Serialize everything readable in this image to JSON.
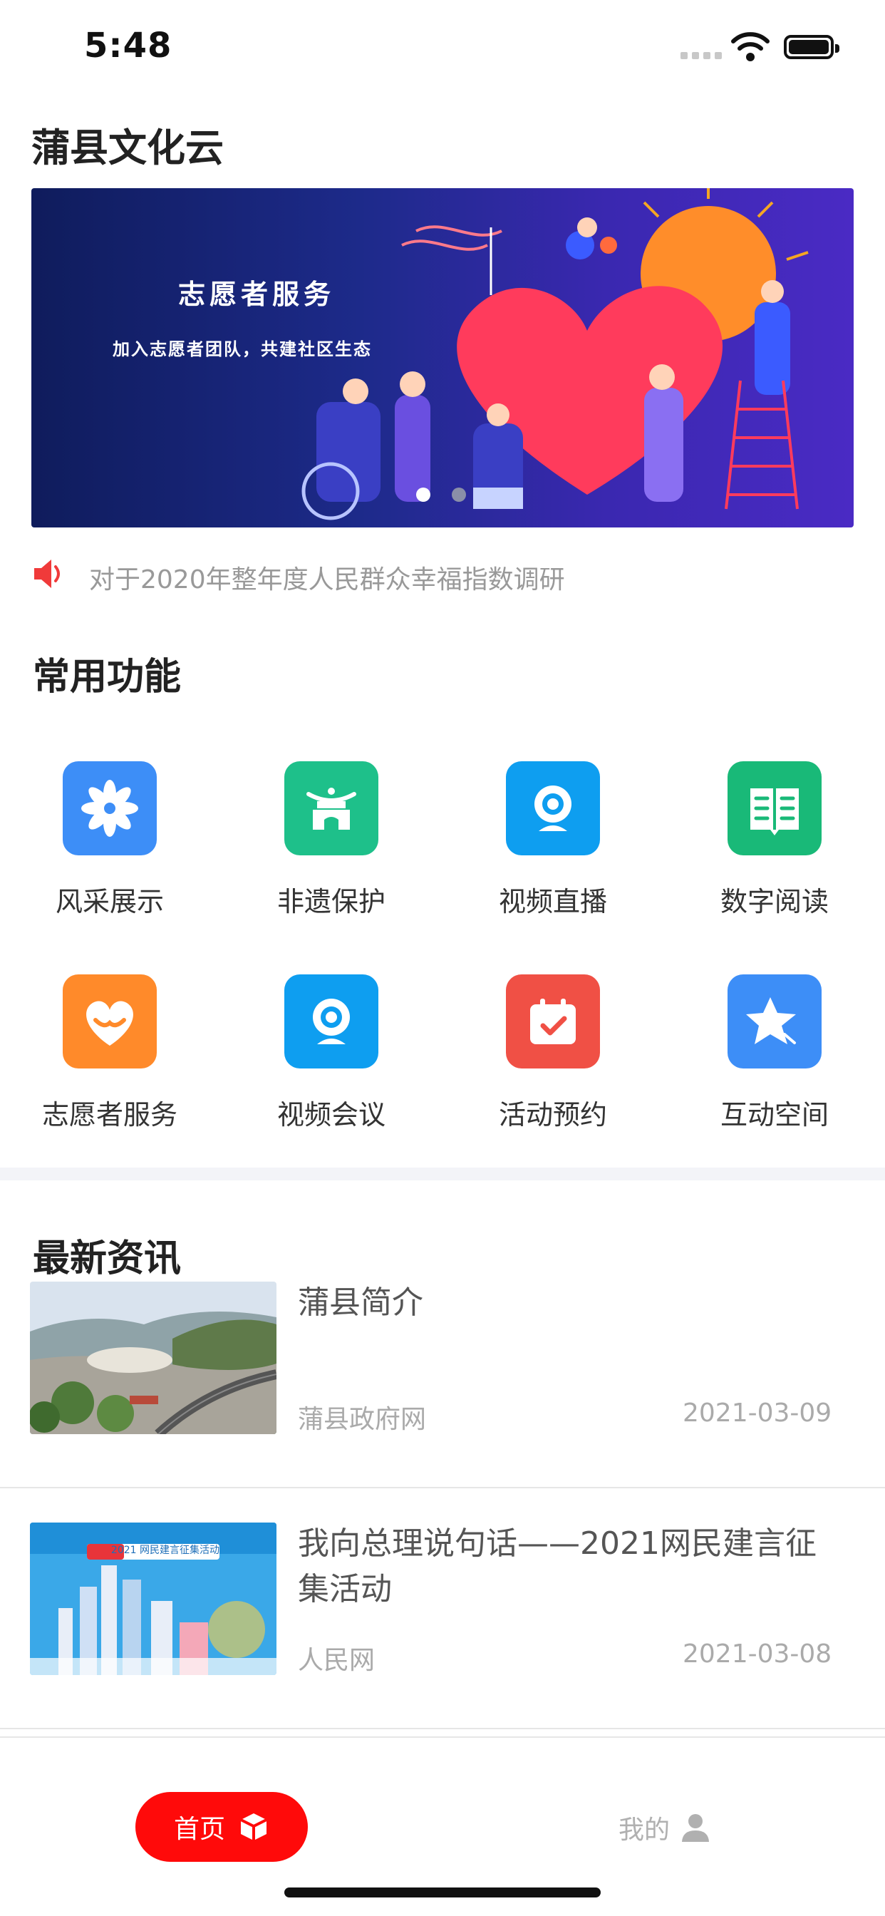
{
  "status_bar": {
    "time": "5:48"
  },
  "app": {
    "title": "蒲县文化云"
  },
  "banner": {
    "title": "志愿者服务",
    "subtitle": "加入志愿者团队，共建社区生态",
    "page_count": 2,
    "active_index": 0
  },
  "notice": {
    "icon": "speaker-icon",
    "text": "对于2020年整年度人民群众幸福指数调研"
  },
  "functions": {
    "section_title": "常用功能",
    "items": [
      {
        "label": "风采展示",
        "icon": "flower-icon",
        "color": "#3d8ef7"
      },
      {
        "label": "非遗保护",
        "icon": "heritage-building-icon",
        "color": "#1ec08a"
      },
      {
        "label": "视频直播",
        "icon": "webcam-icon",
        "color": "#0e9ef0"
      },
      {
        "label": "数字阅读",
        "icon": "open-book-icon",
        "color": "#19b978"
      },
      {
        "label": "志愿者服务",
        "icon": "heart-hands-icon",
        "color": "#ff8a2a"
      },
      {
        "label": "视频会议",
        "icon": "webcam-icon",
        "color": "#0e9ef0"
      },
      {
        "label": "活动预约",
        "icon": "calendar-check-icon",
        "color": "#f05045"
      },
      {
        "label": "互动空间",
        "icon": "star-icon",
        "color": "#3d8ef7"
      }
    ]
  },
  "news": {
    "section_title": "最新资讯",
    "items": [
      {
        "title": "蒲县简介",
        "source": "蒲县政府网",
        "date": "2021-03-09"
      },
      {
        "title": "我向总理说句话——2021网民建言征集活动",
        "source": "人民网",
        "date": "2021-03-08",
        "image_caption": "2021 网民建言征集活动"
      }
    ]
  },
  "tabbar": {
    "items": [
      {
        "label": "首页",
        "icon": "cube-icon",
        "active": true,
        "color": "#ff0a0a"
      },
      {
        "label": "我的",
        "icon": "user-icon",
        "active": false
      }
    ]
  }
}
